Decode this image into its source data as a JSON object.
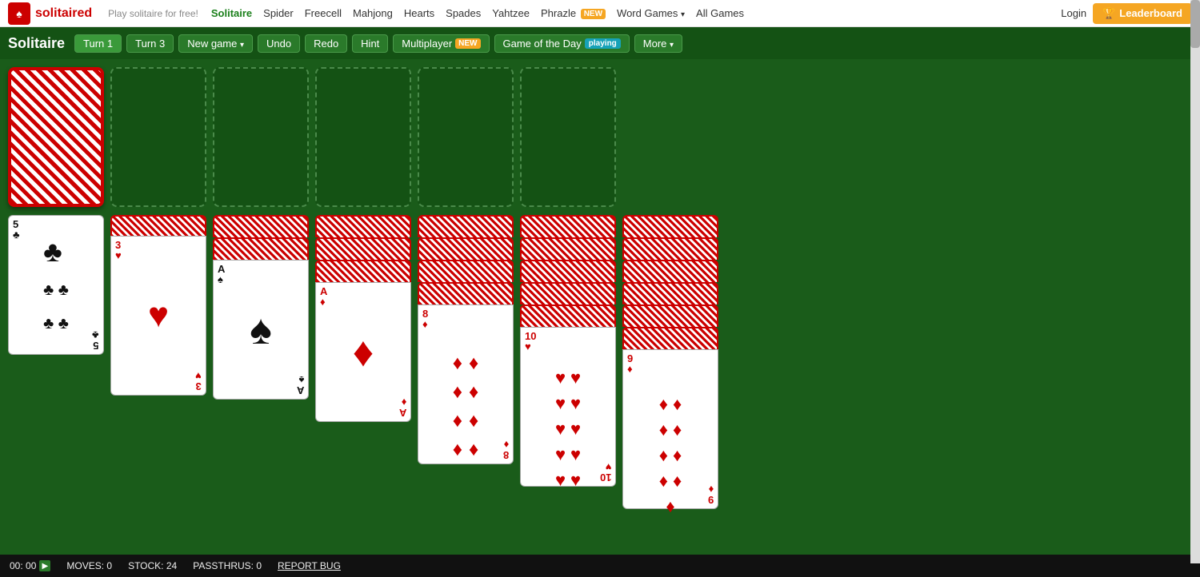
{
  "site": {
    "logo_text": "solitaired",
    "logo_icon": "S",
    "tagline": "Play solitaire for free!"
  },
  "nav": {
    "links": [
      {
        "label": "Solitaire",
        "active": true
      },
      {
        "label": "Spider",
        "active": false
      },
      {
        "label": "Freecell",
        "active": false
      },
      {
        "label": "Mahjong",
        "active": false
      },
      {
        "label": "Hearts",
        "active": false
      },
      {
        "label": "Spades",
        "active": false
      },
      {
        "label": "Yahtzee",
        "active": false
      },
      {
        "label": "Phrazle",
        "active": false,
        "badge": "NEW"
      },
      {
        "label": "Word Games",
        "active": false,
        "has_dropdown": true
      },
      {
        "label": "All Games",
        "active": false
      }
    ],
    "login": "Login",
    "leaderboard": "Leaderboard"
  },
  "toolbar": {
    "game_title": "Solitaire",
    "turn1": "Turn 1",
    "turn3": "Turn 3",
    "new_game": "New game",
    "undo": "Undo",
    "redo": "Redo",
    "hint": "Hint",
    "multiplayer": "Multiplayer",
    "multiplayer_badge": "NEW",
    "gotd": "Game of the Day",
    "playing_badge": "playing",
    "more": "More"
  },
  "status": {
    "time": "00: 00",
    "moves_label": "MOVES: 0",
    "stock_label": "STOCK: 24",
    "passthrus_label": "PASSTHRUS: 0",
    "report": "REPORT BUG"
  }
}
